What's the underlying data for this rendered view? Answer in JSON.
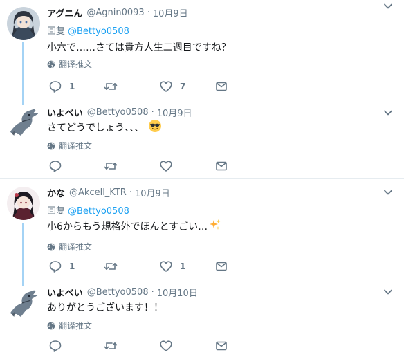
{
  "tweets": [
    {
      "name": "アグニん",
      "handle": "@Agnin0093",
      "date": "10月9日",
      "reply_label": "回复",
      "reply_mention": "@Bettyo0508",
      "text": "小六で……さては貴方人生二週目ですね？",
      "translate_label": "翻译推文",
      "reply_count": "1",
      "retweet_count": "",
      "like_count": "7"
    },
    {
      "name": "いよべい",
      "handle": "@Bettyo0508",
      "date": "10月9日",
      "text": "さてどうでしょう、、、",
      "emoji": "sunglasses-face",
      "translate_label": "翻译推文",
      "reply_count": "",
      "retweet_count": "",
      "like_count": ""
    },
    {
      "name": "かな",
      "handle": "@Akcell_KTR",
      "date": "10月9日",
      "reply_label": "回复",
      "reply_mention": "@Bettyo0508",
      "text": "小6からもう規格外でほんとすごい…",
      "emoji": "sparkles",
      "translate_label": "翻译推文",
      "reply_count": "1",
      "retweet_count": "",
      "like_count": "1"
    },
    {
      "name": "いよべい",
      "handle": "@Bettyo0508",
      "date": "10月10日",
      "text": "ありがとうございます！！",
      "translate_label": "翻译推文",
      "reply_count": "",
      "retweet_count": "",
      "like_count": ""
    }
  ],
  "icons": [
    "reply-icon",
    "retweet-icon",
    "like-icon",
    "message-icon",
    "globe-icon",
    "chevron-down-icon"
  ],
  "colors": {
    "accent": "#1da1f2",
    "thread_line": "#a4d3f5",
    "muted": "#657786",
    "divider": "#e6ecf0"
  }
}
